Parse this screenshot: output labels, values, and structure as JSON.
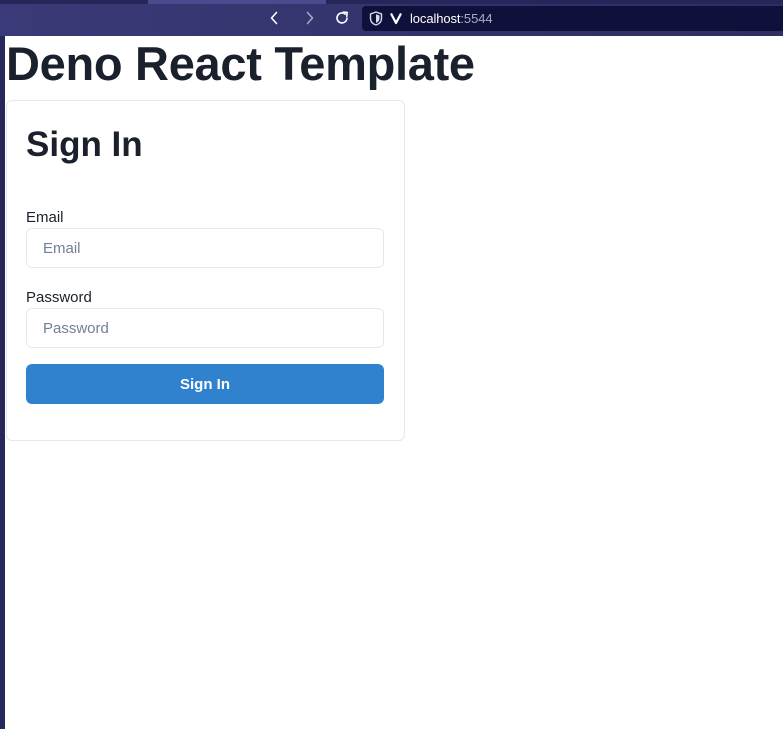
{
  "browser": {
    "url_host": "localhost",
    "url_port": ":5544",
    "icons": {
      "back": "chevron-left-icon",
      "forward": "chevron-right-icon",
      "reload": "reload-icon",
      "security": "shield-icon",
      "site": "site-v-icon"
    }
  },
  "page": {
    "title": "Deno React Template"
  },
  "signin": {
    "heading": "Sign In",
    "email_label": "Email",
    "email_placeholder": "Email",
    "email_value": "",
    "password_label": "Password",
    "password_placeholder": "Password",
    "password_value": "",
    "submit_label": "Sign In"
  },
  "colors": {
    "chrome": "#34346e",
    "urlbar": "#10113a",
    "text": "#1a202c",
    "button": "#3182ce",
    "border": "#e2e8f0",
    "placeholder": "#718096"
  }
}
